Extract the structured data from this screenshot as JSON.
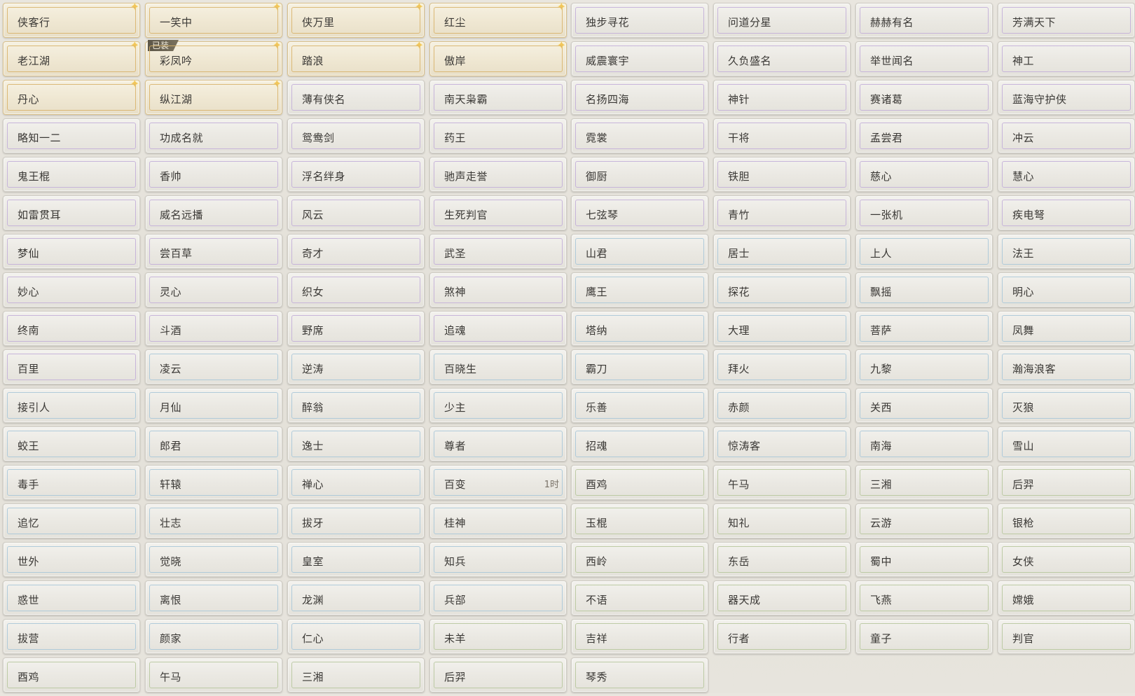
{
  "columns": [
    [
      {
        "label": "侠客行",
        "tier": "gold",
        "spark": true
      },
      {
        "label": "老江湖",
        "tier": "gold",
        "spark": true
      },
      {
        "label": "丹心",
        "tier": "gold",
        "spark": true
      },
      {
        "label": "略知一二",
        "tier": "purple"
      },
      {
        "label": "鬼王棍",
        "tier": "purple"
      },
      {
        "label": "如雷贯耳",
        "tier": "purple"
      },
      {
        "label": "梦仙",
        "tier": "purple"
      },
      {
        "label": "妙心",
        "tier": "purple"
      },
      {
        "label": "终南",
        "tier": "purple"
      },
      {
        "label": "百里",
        "tier": "purple"
      },
      {
        "label": "接引人",
        "tier": "blue"
      },
      {
        "label": "蛟王",
        "tier": "blue"
      },
      {
        "label": "毒手",
        "tier": "blue"
      },
      {
        "label": "追忆",
        "tier": "blue"
      },
      {
        "label": "世外",
        "tier": "blue"
      },
      {
        "label": "惑世",
        "tier": "blue"
      },
      {
        "label": "拔营",
        "tier": "blue"
      },
      {
        "label": "酉鸡",
        "tier": "green"
      }
    ],
    [
      {
        "label": "一笑中",
        "tier": "gold",
        "spark": true
      },
      {
        "label": "彩凤吟",
        "tier": "gold",
        "spark": true,
        "badge": "已装"
      },
      {
        "label": "纵江湖",
        "tier": "gold",
        "spark": true
      },
      {
        "label": "功成名就",
        "tier": "purple"
      },
      {
        "label": "香帅",
        "tier": "purple"
      },
      {
        "label": "威名远播",
        "tier": "purple"
      },
      {
        "label": "尝百草",
        "tier": "purple"
      },
      {
        "label": "灵心",
        "tier": "purple"
      },
      {
        "label": "斗酒",
        "tier": "purple"
      },
      {
        "label": "凌云",
        "tier": "blue"
      },
      {
        "label": "月仙",
        "tier": "blue"
      },
      {
        "label": "郎君",
        "tier": "blue"
      },
      {
        "label": "轩辕",
        "tier": "blue"
      },
      {
        "label": "壮志",
        "tier": "blue"
      },
      {
        "label": "觉晓",
        "tier": "blue"
      },
      {
        "label": "离恨",
        "tier": "blue"
      },
      {
        "label": "颜家",
        "tier": "blue"
      },
      {
        "label": "午马",
        "tier": "green"
      }
    ],
    [
      {
        "label": "侠万里",
        "tier": "gold",
        "spark": true
      },
      {
        "label": "踏浪",
        "tier": "gold",
        "spark": true
      },
      {
        "label": "薄有侠名",
        "tier": "purple"
      },
      {
        "label": "鸳鸯剑",
        "tier": "purple"
      },
      {
        "label": "浮名绊身",
        "tier": "purple"
      },
      {
        "label": "风云",
        "tier": "purple"
      },
      {
        "label": "奇才",
        "tier": "purple"
      },
      {
        "label": "织女",
        "tier": "purple"
      },
      {
        "label": "野席",
        "tier": "purple"
      },
      {
        "label": "逆涛",
        "tier": "blue"
      },
      {
        "label": "醉翁",
        "tier": "blue"
      },
      {
        "label": "逸士",
        "tier": "blue"
      },
      {
        "label": "禅心",
        "tier": "blue"
      },
      {
        "label": "拔牙",
        "tier": "blue"
      },
      {
        "label": "皇室",
        "tier": "blue"
      },
      {
        "label": "龙渊",
        "tier": "blue"
      },
      {
        "label": "仁心",
        "tier": "blue"
      },
      {
        "label": "三湘",
        "tier": "green"
      }
    ],
    [
      {
        "label": "红尘",
        "tier": "gold",
        "spark": true
      },
      {
        "label": "傲岸",
        "tier": "gold",
        "spark": true
      },
      {
        "label": "南天枭霸",
        "tier": "purple"
      },
      {
        "label": "药王",
        "tier": "purple"
      },
      {
        "label": "驰声走誉",
        "tier": "purple"
      },
      {
        "label": "生死判官",
        "tier": "purple"
      },
      {
        "label": "武圣",
        "tier": "purple"
      },
      {
        "label": "煞神",
        "tier": "purple"
      },
      {
        "label": "追魂",
        "tier": "purple"
      },
      {
        "label": "百晓生",
        "tier": "blue"
      },
      {
        "label": "少主",
        "tier": "blue"
      },
      {
        "label": "尊者",
        "tier": "blue"
      },
      {
        "label": "百变",
        "tier": "blue",
        "timer": "1时"
      },
      {
        "label": "桂神",
        "tier": "blue"
      },
      {
        "label": "知兵",
        "tier": "blue"
      },
      {
        "label": "兵部",
        "tier": "blue"
      },
      {
        "label": "未羊",
        "tier": "green"
      },
      {
        "label": "后羿",
        "tier": "green"
      }
    ],
    [
      {
        "label": "独步寻花",
        "tier": "purple"
      },
      {
        "label": "威震寰宇",
        "tier": "purple"
      },
      {
        "label": "名扬四海",
        "tier": "purple"
      },
      {
        "label": "霓裳",
        "tier": "purple"
      },
      {
        "label": "御厨",
        "tier": "purple"
      },
      {
        "label": "七弦琴",
        "tier": "purple"
      },
      {
        "label": "山君",
        "tier": "blue"
      },
      {
        "label": "鹰王",
        "tier": "blue"
      },
      {
        "label": "塔纳",
        "tier": "blue"
      },
      {
        "label": "霸刀",
        "tier": "blue"
      },
      {
        "label": "乐善",
        "tier": "blue"
      },
      {
        "label": "招魂",
        "tier": "blue"
      },
      {
        "label": "酉鸡",
        "tier": "green"
      },
      {
        "label": "玉棍",
        "tier": "green"
      },
      {
        "label": "西岭",
        "tier": "green"
      },
      {
        "label": "不语",
        "tier": "green"
      },
      {
        "label": "吉祥",
        "tier": "green"
      },
      {
        "label": "琴秀",
        "tier": "green"
      }
    ],
    [
      {
        "label": "问道分星",
        "tier": "purple"
      },
      {
        "label": "久负盛名",
        "tier": "purple"
      },
      {
        "label": "神针",
        "tier": "purple"
      },
      {
        "label": "干将",
        "tier": "purple"
      },
      {
        "label": "铁胆",
        "tier": "purple"
      },
      {
        "label": "青竹",
        "tier": "purple"
      },
      {
        "label": "居士",
        "tier": "blue"
      },
      {
        "label": "探花",
        "tier": "blue"
      },
      {
        "label": "大理",
        "tier": "blue"
      },
      {
        "label": "拜火",
        "tier": "blue"
      },
      {
        "label": "赤颜",
        "tier": "blue"
      },
      {
        "label": "惊涛客",
        "tier": "blue"
      },
      {
        "label": "午马",
        "tier": "green"
      },
      {
        "label": "知礼",
        "tier": "green"
      },
      {
        "label": "东岳",
        "tier": "green"
      },
      {
        "label": "器天成",
        "tier": "green"
      },
      {
        "label": "行者",
        "tier": "green"
      }
    ],
    [
      {
        "label": "赫赫有名",
        "tier": "purple"
      },
      {
        "label": "举世闻名",
        "tier": "purple"
      },
      {
        "label": "赛诸葛",
        "tier": "purple"
      },
      {
        "label": "孟尝君",
        "tier": "purple"
      },
      {
        "label": "慈心",
        "tier": "purple"
      },
      {
        "label": "一张机",
        "tier": "purple"
      },
      {
        "label": "上人",
        "tier": "blue"
      },
      {
        "label": "飘摇",
        "tier": "blue"
      },
      {
        "label": "菩萨",
        "tier": "blue"
      },
      {
        "label": "九黎",
        "tier": "blue"
      },
      {
        "label": "关西",
        "tier": "blue"
      },
      {
        "label": "南海",
        "tier": "blue"
      },
      {
        "label": "三湘",
        "tier": "green"
      },
      {
        "label": "云游",
        "tier": "green"
      },
      {
        "label": "蜀中",
        "tier": "green"
      },
      {
        "label": "飞燕",
        "tier": "green"
      },
      {
        "label": "童子",
        "tier": "green"
      }
    ],
    [
      {
        "label": "芳满天下",
        "tier": "purple"
      },
      {
        "label": "神工",
        "tier": "purple"
      },
      {
        "label": "蓝海守护侠",
        "tier": "purple"
      },
      {
        "label": "冲云",
        "tier": "purple"
      },
      {
        "label": "慧心",
        "tier": "purple"
      },
      {
        "label": "疾电弩",
        "tier": "purple"
      },
      {
        "label": "法王",
        "tier": "blue"
      },
      {
        "label": "明心",
        "tier": "blue"
      },
      {
        "label": "凤舞",
        "tier": "blue"
      },
      {
        "label": "瀚海浪客",
        "tier": "blue"
      },
      {
        "label": "灭狼",
        "tier": "blue"
      },
      {
        "label": "雪山",
        "tier": "blue"
      },
      {
        "label": "后羿",
        "tier": "green"
      },
      {
        "label": "银枪",
        "tier": "green"
      },
      {
        "label": "女侠",
        "tier": "green"
      },
      {
        "label": "嫦娥",
        "tier": "green"
      },
      {
        "label": "判官",
        "tier": "green"
      }
    ]
  ]
}
